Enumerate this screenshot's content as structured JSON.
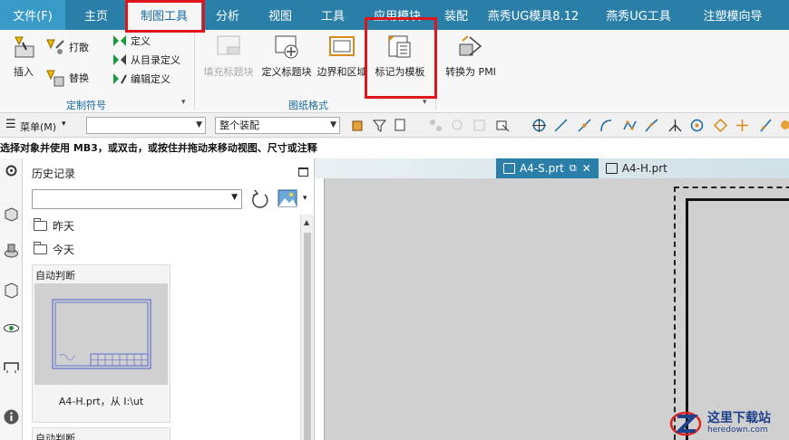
{
  "menubar": {
    "file_label": "文件(F)",
    "tabs": [
      "主页",
      "制图工具",
      "分析",
      "视图",
      "工具",
      "应用模块",
      "装配",
      "燕秀UG模具8.12",
      "燕秀UG工具",
      "注塑模向导"
    ]
  },
  "ribbon": {
    "insert_label": "插入",
    "scatter_label": "打散",
    "replace_label": "替换",
    "define_label": "定义",
    "from_dir_label": "从目录定义",
    "edit_def_label": "编辑定义",
    "group1_label": "定制符号",
    "fill_title_label": "填充标题块",
    "define_title_label": "定义标题块",
    "border_zone_label": "边界和区域",
    "mark_template_label": "标记为模板",
    "group2_label": "图纸格式",
    "convert_pmi_label": "转换为 PMI"
  },
  "toolbar": {
    "menu_label": "菜单(M)",
    "filter_value": "",
    "scope_value": "整个装配"
  },
  "status": {
    "message": "选择对象并使用 MB3，或双击，或按住并拖动来移动视图、尺寸或注释"
  },
  "history": {
    "title": "历史记录",
    "combo_value": "",
    "folders": [
      "昨天",
      "今天"
    ],
    "card1_head": "自动判断",
    "card1_caption": "A4-H.prt，从 I:\\ut",
    "card2_head": "自动判断"
  },
  "docs": {
    "tab1": "A4-S.prt",
    "tab2": "A4-H.prt"
  },
  "watermark": {
    "cn": "这里下载站",
    "en": "heredown.com"
  },
  "colors": {
    "menubar": "#2a7fa8",
    "highlight_box": "#e0141b",
    "group_label": "#1a6aa0"
  }
}
